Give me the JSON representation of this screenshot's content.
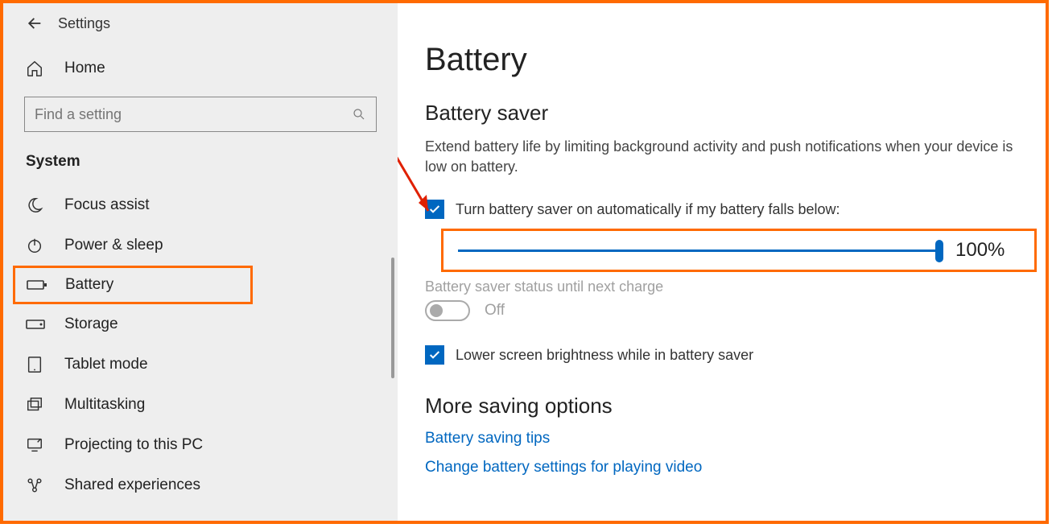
{
  "header": {
    "title": "Settings"
  },
  "home": {
    "label": "Home"
  },
  "search": {
    "placeholder": "Find a setting"
  },
  "section": {
    "label": "System"
  },
  "nav": {
    "focus": "Focus assist",
    "power": "Power & sleep",
    "battery": "Battery",
    "storage": "Storage",
    "tablet": "Tablet mode",
    "multi": "Multitasking",
    "project": "Projecting to this PC",
    "shared": "Shared experiences"
  },
  "main": {
    "title": "Battery",
    "saver_heading": "Battery saver",
    "saver_desc": "Extend battery life by limiting background activity and push notifications when your device is low on battery.",
    "auto_label": "Turn battery saver on automatically if my battery falls below:",
    "slider_value": "100%",
    "status_label": "Battery saver status until next charge",
    "toggle_label": "Off",
    "brightness_label": "Lower screen brightness while in battery saver",
    "more_heading": "More saving options",
    "link_tips": "Battery saving tips",
    "link_video": "Change battery settings for playing video"
  }
}
